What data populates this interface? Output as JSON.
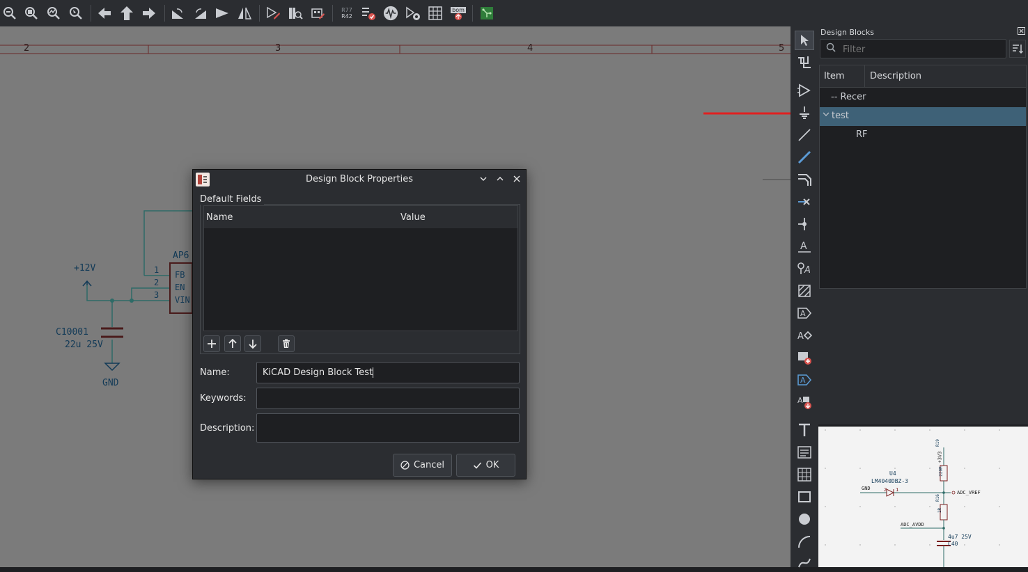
{
  "toolbar": {
    "icons": [
      "zoom-out-icon",
      "zoom-fit-icon",
      "zoom-objects-icon",
      "zoom-selection-icon",
      "navigate-back-icon",
      "navigate-up-icon",
      "navigate-forward-icon",
      "rotate-ccw-icon",
      "rotate-cw-icon",
      "mirror-horizontal-icon",
      "mirror-vertical-icon",
      "symbol-editor-icon",
      "symbol-library-browser-icon",
      "footprint-assign-icon",
      "annotate-icon",
      "erc-icon",
      "simulator-icon",
      "spice-icon",
      "bom-table-icon",
      "bom-export-icon",
      "pcb-editor-icon"
    ],
    "annotate_text_top": "R77",
    "annotate_text_bottom": "R42",
    "bom_text": "bom"
  },
  "canvas": {
    "ruler_numbers": [
      "2",
      "3",
      "4",
      "5"
    ],
    "net_labels": {
      "power_label": "+12V",
      "cap_ref": "C10001",
      "cap_value": "22u 25V",
      "ground": "GND",
      "chip_name": "AP6",
      "pin1": "1",
      "pin2": "2",
      "pin3": "3",
      "pin_fb": "FB",
      "pin_en": "EN",
      "pin_vin": "VIN"
    }
  },
  "vertical_tools": [
    "select-icon",
    "highlight-net-icon",
    "add-symbol-icon",
    "add-power-icon",
    "add-line-icon",
    "add-wire-icon",
    "add-bus-icon",
    "no-connect-icon",
    "add-junction-icon",
    "add-label-icon",
    "add-net-class-icon",
    "add-rule-area-icon",
    "add-global-label-icon",
    "add-hier-label-icon",
    "add-sheet-icon",
    "import-sheet-pin-icon",
    "sync-sheet-pins-icon",
    "add-text-icon",
    "add-textbox-icon",
    "add-table-icon",
    "add-rectangle-icon",
    "add-circle-icon",
    "add-arc-icon",
    "add-bezier-icon"
  ],
  "panel": {
    "title": "Design Blocks",
    "filter_placeholder": "Filter",
    "columns": {
      "item": "Item",
      "description": "Description"
    },
    "rows": [
      {
        "label": "-- Recer"
      },
      {
        "label": "test"
      },
      {
        "label": "RF"
      }
    ]
  },
  "preview": {
    "u4_ref": "U4",
    "u4_value": "LM4040DBZ-3",
    "gnd": "GND",
    "pin2": "2",
    "pin1": "1",
    "adc_vref": "ADC_VREF",
    "adc_avdd": "ADC_AVDD",
    "cap_value": "4u7 25V",
    "cap_ref": "C40",
    "r_top": "220R",
    "r_bottom": "1R",
    "net_top": "+3V3",
    "r_top_ref": "R19",
    "r_bottom_ref": "R16"
  },
  "dialog": {
    "title": "Design Block Properties",
    "group_label": "Default Fields",
    "grid_columns": {
      "name": "Name",
      "value": "Value"
    },
    "name_label": "Name:",
    "name_value": "KiCAD Design Block Test",
    "keywords_label": "Keywords:",
    "keywords_value": "",
    "description_label": "Description:",
    "description_value": "",
    "cancel_label": "Cancel",
    "ok_label": "OK"
  },
  "colors": {
    "accent_selected": "#3e6177",
    "annotation_arrow": "#e02020",
    "wire": "#2e6b67",
    "symbol_body": "#123a57"
  }
}
